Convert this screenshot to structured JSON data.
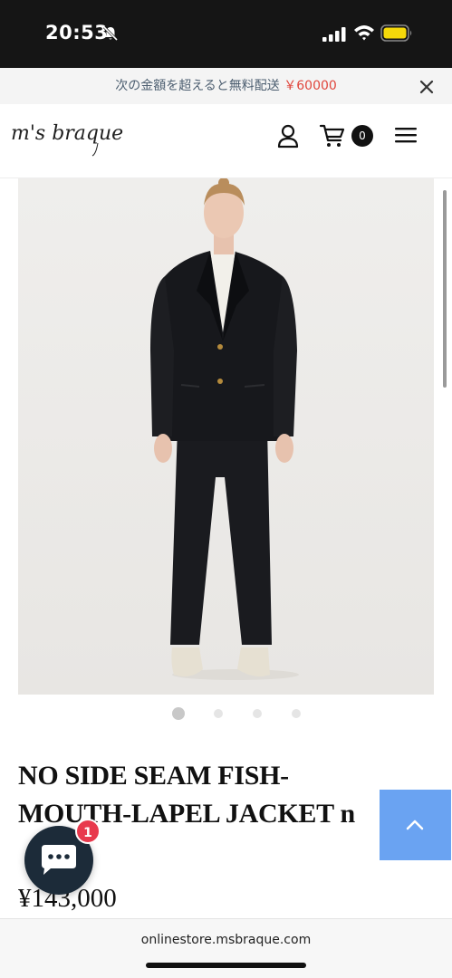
{
  "status_bar": {
    "time": "20:53",
    "icons": [
      "bell-slash-icon",
      "signal-icon",
      "wifi-icon",
      "battery-icon"
    ],
    "battery_color": "#f5d90a"
  },
  "promo": {
    "text": "次の金額を超えると無料配送",
    "amount": "￥60000",
    "amount_color": "#e0463c"
  },
  "header": {
    "logo_text": "m's braque",
    "cart_count": "0",
    "icons": [
      "user-icon",
      "cart-icon",
      "menu-icon"
    ]
  },
  "gallery": {
    "slide_count": 4,
    "active_index": 0
  },
  "product": {
    "title": "NO SIDE SEAM FISH-MOUTH-LAPEL JACKET n",
    "price": "¥143,000"
  },
  "chat": {
    "badge": "1",
    "color": "#1c2b39"
  },
  "scroll_top": {
    "color": "#6aa3f2"
  },
  "browser": {
    "url": "onlinestore.msbraque.com"
  }
}
